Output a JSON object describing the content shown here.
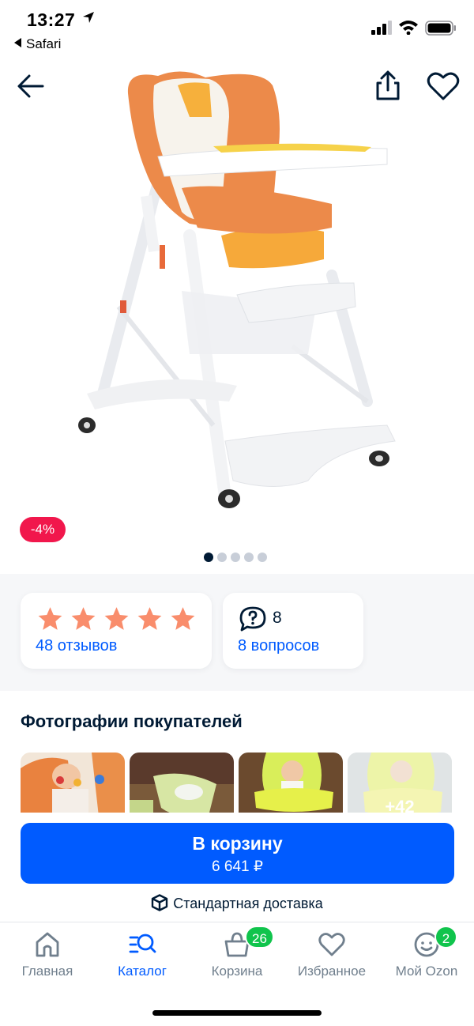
{
  "status_bar": {
    "time": "13:27",
    "back_app": "Safari"
  },
  "product": {
    "discount_badge": "-4%",
    "gallery_total": 5,
    "gallery_active": 1
  },
  "rating": {
    "stars": 5,
    "reviews_label": "48 отзывов"
  },
  "questions": {
    "count": "8",
    "label": "8 вопросов"
  },
  "photos_section": {
    "title": "Фотографии покупателей",
    "more_label": "+42"
  },
  "cart": {
    "button_label": "В корзину",
    "price": "6 641 ₽"
  },
  "delivery": {
    "label": "Стандартная доставка"
  },
  "tabbar": {
    "items": [
      {
        "label": "Главная",
        "icon": "home-icon"
      },
      {
        "label": "Каталог",
        "icon": "catalog-search-icon",
        "active": true
      },
      {
        "label": "Корзина",
        "icon": "cart-icon",
        "badge": "26"
      },
      {
        "label": "Избранное",
        "icon": "heart-icon"
      },
      {
        "label": "Мой Ozon",
        "icon": "profile-face-icon",
        "badge": "2"
      }
    ]
  },
  "colors": {
    "accent": "#005bff",
    "discount": "#f1174c",
    "star": "#f98d6c",
    "badge": "#10c44c",
    "text": "#001a34"
  }
}
